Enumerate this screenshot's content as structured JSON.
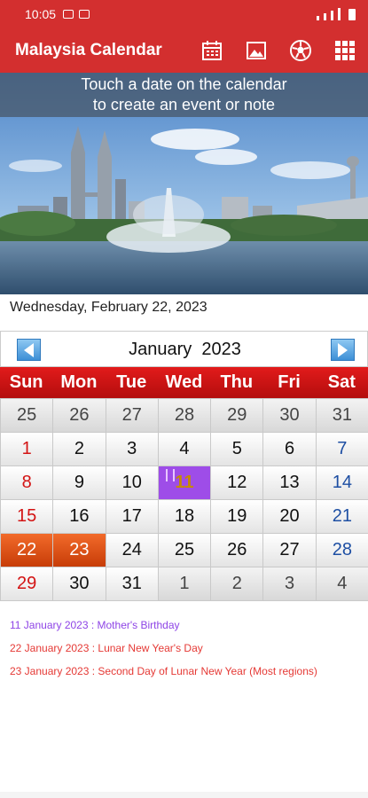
{
  "status_bar": {
    "time": "10:05"
  },
  "app_bar": {
    "title": "Malaysia Calendar",
    "icons": [
      "calendar-list-icon",
      "image-icon",
      "soccer-ball-icon",
      "grid-menu-icon"
    ]
  },
  "banner": {
    "hint_line1": "Touch a date on the calendar",
    "hint_line2": "to create an event or note"
  },
  "current_date": "Wednesday, February 22, 2023",
  "calendar": {
    "month_title": "January  2023",
    "weekdays": [
      "Sun",
      "Mon",
      "Tue",
      "Wed",
      "Thu",
      "Fri",
      "Sat"
    ],
    "weeks": [
      [
        "25",
        "26",
        "27",
        "28",
        "29",
        "30",
        "31"
      ],
      [
        "1",
        "2",
        "3",
        "4",
        "5",
        "6",
        "7"
      ],
      [
        "8",
        "9",
        "10",
        "11",
        "12",
        "13",
        "14"
      ],
      [
        "15",
        "16",
        "17",
        "18",
        "19",
        "20",
        "21"
      ],
      [
        "22",
        "23",
        "24",
        "25",
        "26",
        "27",
        "28"
      ],
      [
        "29",
        "30",
        "31",
        "1",
        "2",
        "3",
        "4"
      ]
    ]
  },
  "events": [
    {
      "text": "11 January 2023 : Mother's Birthday",
      "color": "#8e44e6"
    },
    {
      "text": "22 January 2023 : Lunar New Year's Day",
      "color": "#e53935"
    },
    {
      "text": "23 January 2023 : Second Day of Lunar New Year (Most regions)",
      "color": "#e53935"
    }
  ],
  "colors": {
    "primary": "#d32f2f",
    "holiday": "#e0561a",
    "event": "#9e4de8",
    "sunday": "#d31414",
    "saturday": "#1e4fa3"
  }
}
